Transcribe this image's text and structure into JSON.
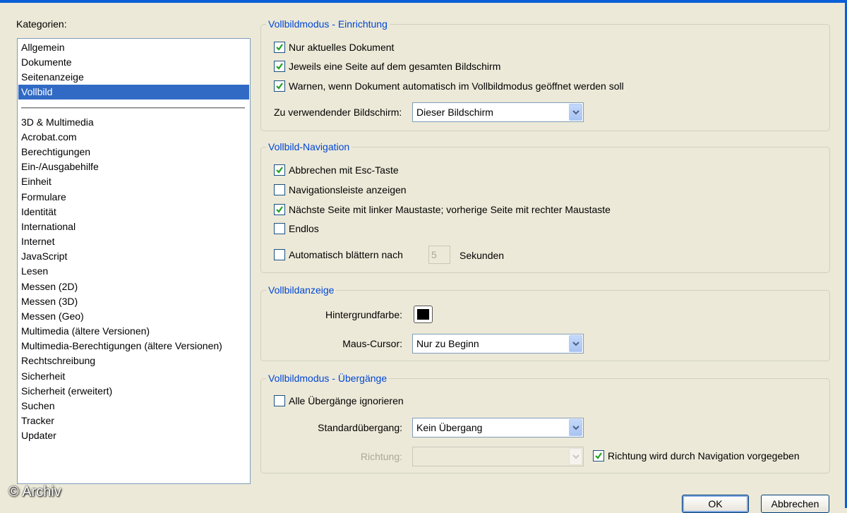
{
  "categories": {
    "label": "Kategorien:",
    "top_items": [
      "Allgemein",
      "Dokumente",
      "Seitenanzeige",
      "Vollbild"
    ],
    "selected": "Vollbild",
    "items": [
      "3D & Multimedia",
      "Acrobat.com",
      "Berechtigungen",
      "Ein-/Ausgabehilfe",
      "Einheit",
      "Formulare",
      "Identität",
      "International",
      "Internet",
      "JavaScript",
      "Lesen",
      "Messen (2D)",
      "Messen (3D)",
      "Messen (Geo)",
      "Multimedia (ältere Versionen)",
      "Multimedia-Berechtigungen (ältere Versionen)",
      "Rechtschreibung",
      "Sicherheit",
      "Sicherheit (erweitert)",
      "Suchen",
      "Tracker",
      "Updater"
    ]
  },
  "setup": {
    "title": "Vollbildmodus - Einrichtung",
    "current_doc_only": {
      "label": "Nur aktuelles Dokument",
      "checked": true
    },
    "one_page": {
      "label": "Jeweils eine Seite auf dem gesamten Bildschirm",
      "checked": true
    },
    "warn_auto": {
      "label": "Warnen, wenn Dokument automatisch im Vollbildmodus geöffnet werden soll",
      "checked": true
    },
    "screen_label": "Zu verwendender Bildschirm:",
    "screen_value": "Dieser Bildschirm"
  },
  "navigation": {
    "title": "Vollbild-Navigation",
    "esc_exit": {
      "label": "Abbrechen mit Esc-Taste",
      "checked": true
    },
    "show_navbar": {
      "label": "Navigationsleiste anzeigen",
      "checked": false
    },
    "mouse_click": {
      "label": "Nächste Seite mit linker Maustaste; vorherige Seite mit rechter Maustaste",
      "checked": true
    },
    "loop": {
      "label": "Endlos",
      "checked": false
    },
    "auto_advance": {
      "label": "Automatisch blättern nach",
      "checked": false
    },
    "seconds_value": "5",
    "seconds_unit": "Sekunden"
  },
  "display": {
    "title": "Vollbildanzeige",
    "bg_label": "Hintergrundfarbe:",
    "bg_color": "#000000",
    "cursor_label": "Maus-Cursor:",
    "cursor_value": "Nur zu Beginn"
  },
  "transitions": {
    "title": "Vollbildmodus - Übergänge",
    "ignore_all": {
      "label": "Alle Übergänge ignorieren",
      "checked": false
    },
    "default_label": "Standardübergang:",
    "default_value": "Kein Übergang",
    "direction_label": "Richtung:",
    "direction_value": "",
    "direction_nav": {
      "label": "Richtung wird durch Navigation vorgegeben",
      "checked": true
    }
  },
  "buttons": {
    "ok": "OK",
    "cancel": "Abbrechen"
  },
  "watermark": "© Archiv",
  "colors": {
    "accent": "#316ac5",
    "group_title": "#0046d5",
    "dialog_bg": "#ece9d8"
  }
}
